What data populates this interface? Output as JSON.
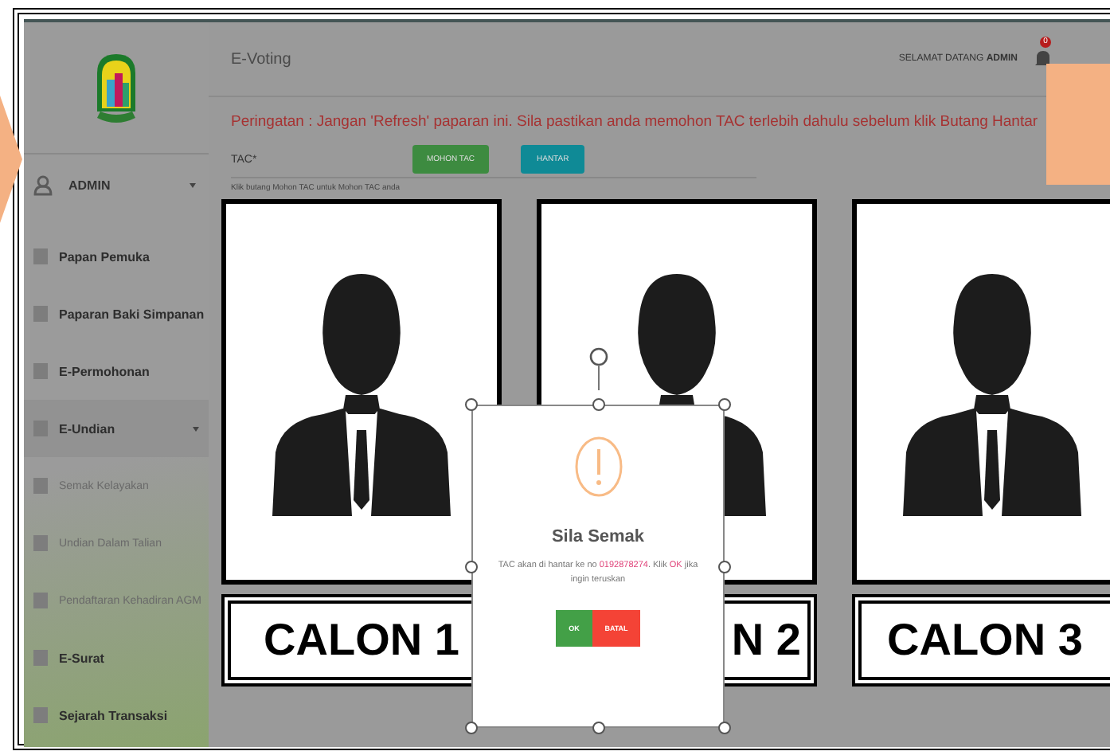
{
  "sidebar": {
    "user": {
      "name": "ADMIN"
    },
    "items": [
      {
        "label": "Papan Pemuka",
        "kind": "main"
      },
      {
        "label": "Paparan Baki Simpanan",
        "kind": "main"
      },
      {
        "label": "E-Permohonan",
        "kind": "main"
      },
      {
        "label": "E-Undian",
        "kind": "main",
        "expanded": true
      },
      {
        "label": "Semak Kelayakan",
        "kind": "sub"
      },
      {
        "label": "Undian Dalam Talian",
        "kind": "sub"
      },
      {
        "label": "Pendaftaran Kehadiran AGM",
        "kind": "sub"
      },
      {
        "label": "E-Surat",
        "kind": "main"
      },
      {
        "label": "Sejarah Transaksi",
        "kind": "main"
      }
    ]
  },
  "header": {
    "title": "E-Voting",
    "greeting": "SELAMAT DATANG",
    "user": "ADMIN",
    "notification_count": "0"
  },
  "panel": {
    "warning": "Peringatan : Jangan 'Refresh' paparan ini. Sila pastikan anda memohon TAC terlebih dahulu sebelum klik Butang Hantar",
    "tac_label": "TAC*",
    "buttons": [
      "MOHON TAC",
      "HANTAR"
    ],
    "help": "Klik butang Mohon TAC untuk Mohon TAC anda"
  },
  "candidates": [
    {
      "label": "CALON 1"
    },
    {
      "label": "N 2"
    },
    {
      "label": "CALON 3"
    }
  ],
  "dialog": {
    "title": "Sila Semak",
    "message": "TAC akan di hantar ke no **0192878274**. Klik **OK** jika ingin teruskan",
    "buttons": [
      "OK",
      "BATAL"
    ]
  }
}
